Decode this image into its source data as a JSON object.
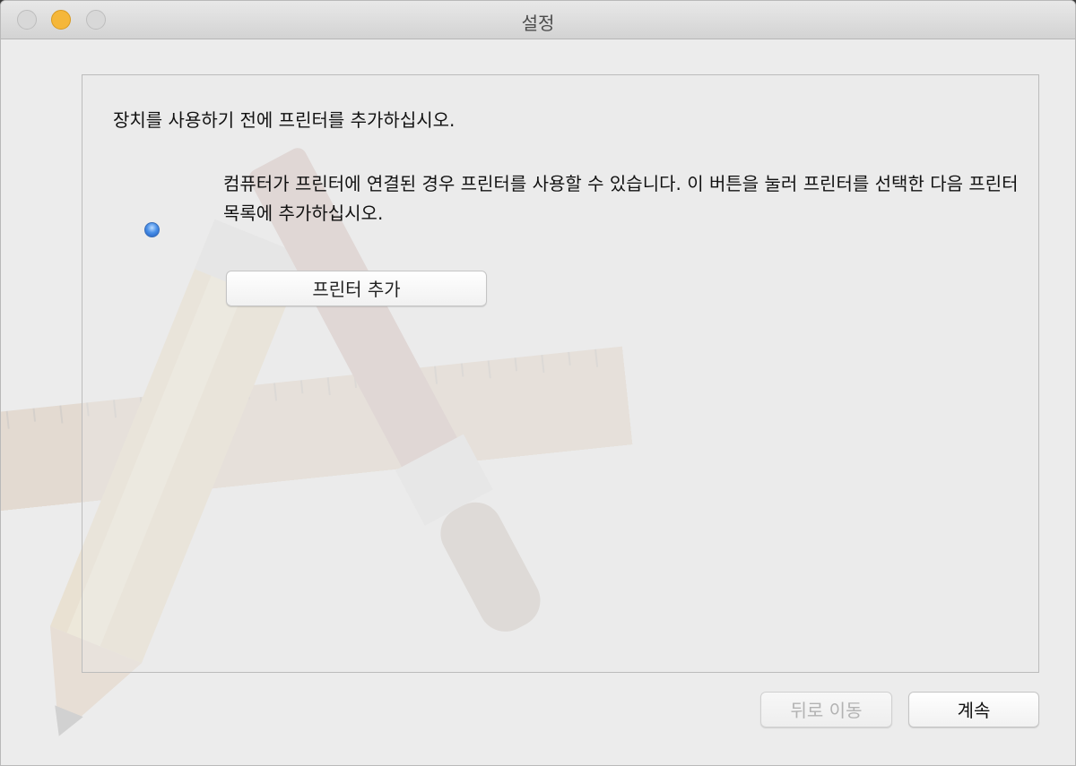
{
  "window": {
    "title": "설정"
  },
  "content": {
    "heading": "장치를 사용하기 전에 프린터를 추가하십시오.",
    "description": "컴퓨터가 프린터에 연결된 경우 프린터를 사용할 수 있습니다. 이 버튼을 눌러 프린터를 선택한 다음 프린터 목록에 추가하십시오.",
    "add_printer_label": "프린터 추가"
  },
  "footer": {
    "back_label": "뒤로 이동",
    "continue_label": "계속"
  },
  "colors": {
    "window_bg": "#ececec",
    "minimize_button": "#f5b73a",
    "radio_accent": "#4a90e8"
  },
  "icons": [
    "close-icon",
    "minimize-icon",
    "zoom-icon",
    "radio-selected-icon"
  ]
}
